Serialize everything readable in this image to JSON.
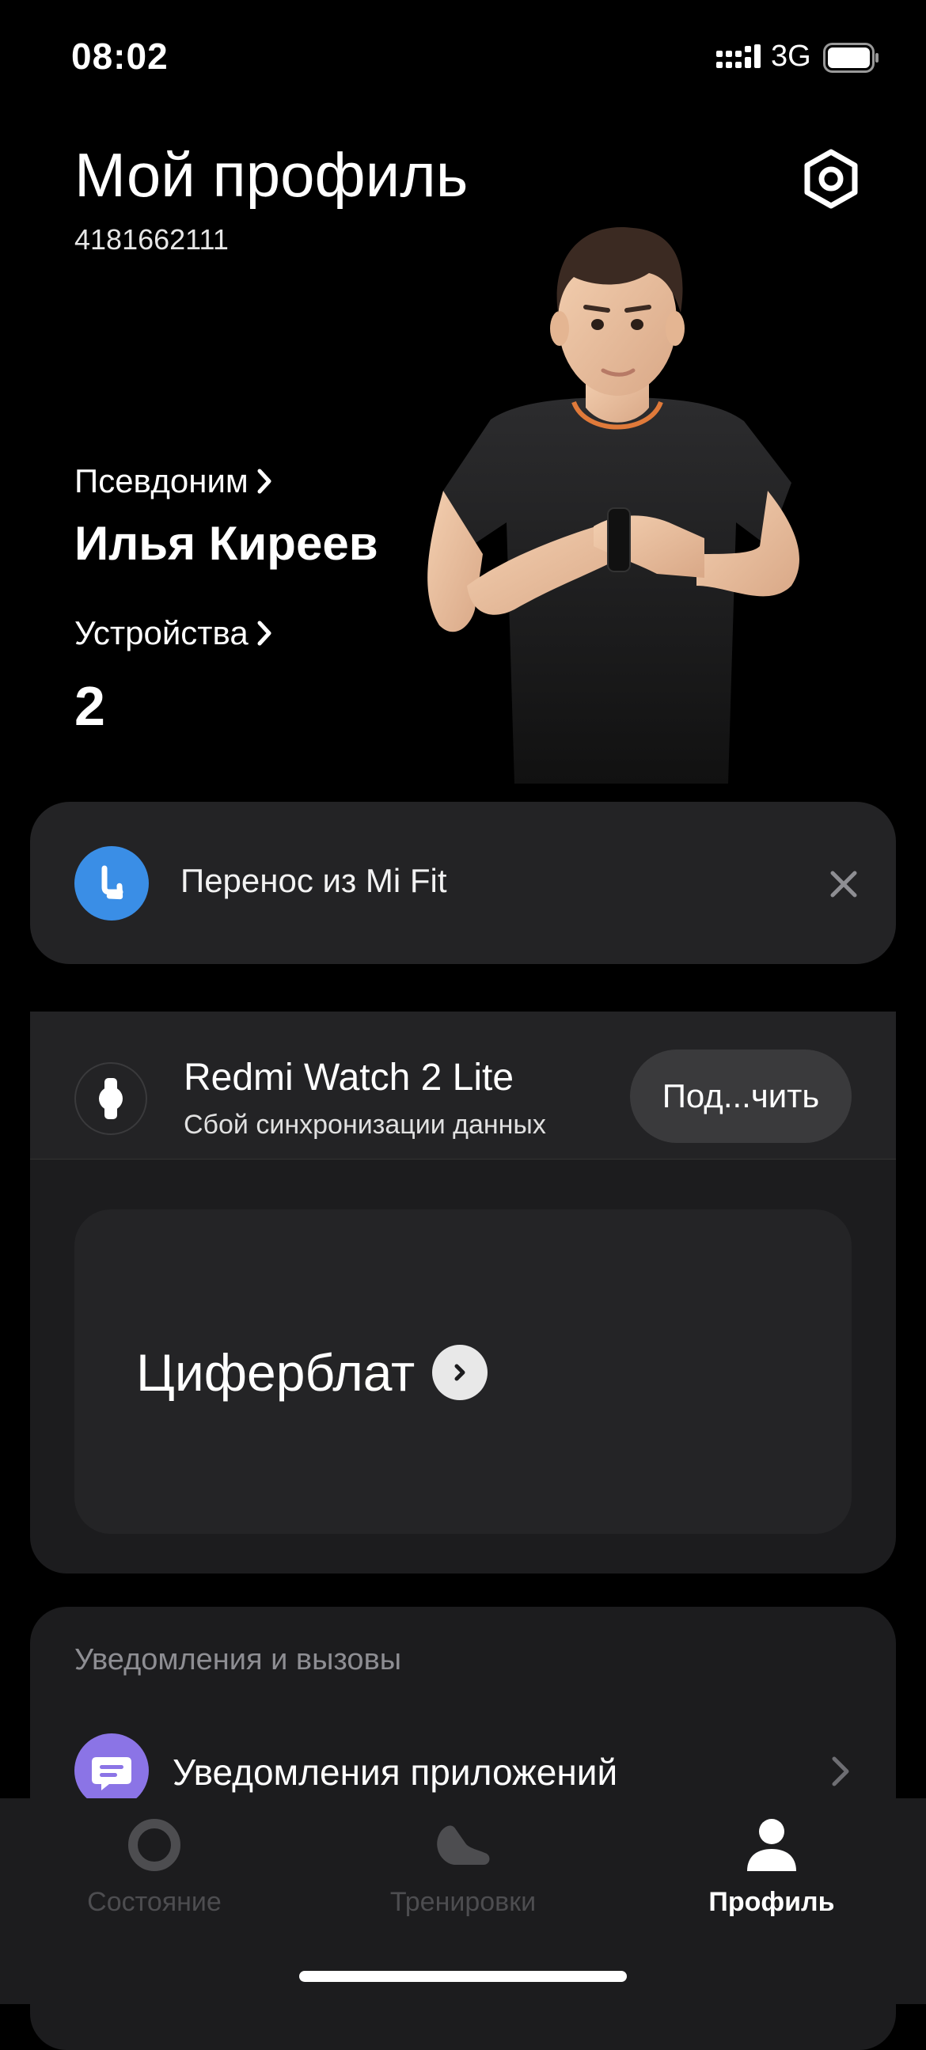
{
  "status_bar": {
    "time": "08:02",
    "network": "3G"
  },
  "header": {
    "title": "Мой профиль",
    "user_id": "4181662111"
  },
  "profile": {
    "nickname_label": "Псевдоним",
    "nickname": "Илья Киреев",
    "devices_label": "Устройства",
    "devices_count": "2"
  },
  "migration_banner": {
    "text": "Перенос из Mi Fit"
  },
  "device": {
    "name": "Redmi Watch 2 Lite",
    "status": "Сбой синхронизации данных",
    "connect_label": "Под...чить",
    "watchface_label": "Циферблат"
  },
  "notifications": {
    "section_title": "Уведомления и вызовы",
    "app_notifications_label": "Уведомления приложений"
  },
  "tabs": [
    {
      "label": "Состояние",
      "icon": "ring-icon",
      "active": false
    },
    {
      "label": "Тренировки",
      "icon": "shoe-icon",
      "active": false
    },
    {
      "label": "Профиль",
      "icon": "person-icon",
      "active": true
    }
  ],
  "colors": {
    "background": "#000000",
    "card": "#1c1c1e",
    "migration_icon": "#3a8ee6",
    "notification_icon": "#8b74e6",
    "tab_inactive": "#4d4d50",
    "tab_active": "#ffffff"
  }
}
